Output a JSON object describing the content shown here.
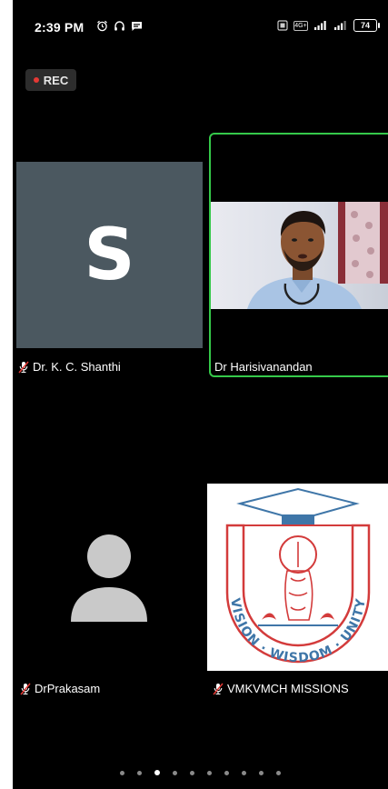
{
  "status_bar": {
    "time": "2:39 PM",
    "network_label": "4G+",
    "battery": "74"
  },
  "recording": {
    "label": "REC",
    "dot_color": "#e53935"
  },
  "participants": [
    {
      "name": "Dr. K. C. Shanthi",
      "avatar_initial": "S",
      "muted": true,
      "active_speaker": false
    },
    {
      "name": "Dr Harisivanandan",
      "muted": false,
      "active_speaker": true
    },
    {
      "name": "DrPrakasam",
      "muted": true,
      "active_speaker": false
    },
    {
      "name": "VMKVMCH MISSIONS",
      "muted": true,
      "active_speaker": false
    }
  ],
  "logo": {
    "motto": "VISION · WISDOM · UNITY"
  },
  "pagination": {
    "total": 10,
    "current": 3
  },
  "colors": {
    "active_speaker_border": "#35c94a",
    "avatar_tile_bg": "#4b5860",
    "logo_red": "#d33b3b",
    "logo_blue": "#3f76a8"
  }
}
